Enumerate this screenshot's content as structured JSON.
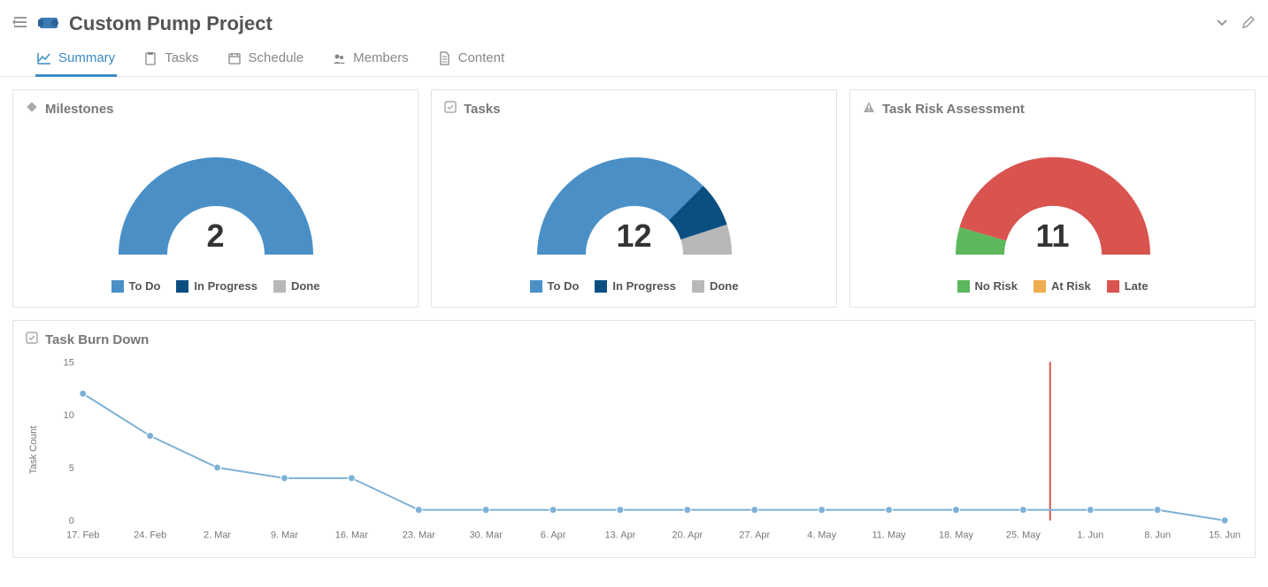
{
  "header": {
    "title": "Custom Pump Project"
  },
  "tabs": [
    {
      "label": "Summary",
      "active": true
    },
    {
      "label": "Tasks",
      "active": false
    },
    {
      "label": "Schedule",
      "active": false
    },
    {
      "label": "Members",
      "active": false
    },
    {
      "label": "Content",
      "active": false
    }
  ],
  "cards": {
    "milestones": {
      "title": "Milestones",
      "total": "2",
      "legend": [
        {
          "label": "To Do",
          "color": "#4a90c7"
        },
        {
          "label": "In Progress",
          "color": "#0b4f81"
        },
        {
          "label": "Done",
          "color": "#b8b8b8"
        }
      ]
    },
    "tasks": {
      "title": "Tasks",
      "total": "12",
      "legend": [
        {
          "label": "To Do",
          "color": "#4a90c7"
        },
        {
          "label": "In Progress",
          "color": "#0b4f81"
        },
        {
          "label": "Done",
          "color": "#b8b8b8"
        }
      ]
    },
    "risk": {
      "title": "Task Risk Assessment",
      "total": "11",
      "legend": [
        {
          "label": "No Risk",
          "color": "#5cb85c"
        },
        {
          "label": "At Risk",
          "color": "#f0ad4e"
        },
        {
          "label": "Late",
          "color": "#d9534f"
        }
      ]
    }
  },
  "burndown": {
    "title": "Task Burn Down",
    "ylabel": "Task Count",
    "yticks": [
      "0",
      "5",
      "10",
      "15"
    ]
  },
  "chart_data": [
    {
      "name": "milestones",
      "type": "pie",
      "title": "Milestones",
      "total": 2,
      "series": [
        {
          "name": "To Do",
          "value": 2
        },
        {
          "name": "In Progress",
          "value": 0
        },
        {
          "name": "Done",
          "value": 0
        }
      ]
    },
    {
      "name": "tasks",
      "type": "pie",
      "title": "Tasks",
      "total": 12,
      "series": [
        {
          "name": "To Do",
          "value": 9
        },
        {
          "name": "In Progress",
          "value": 2
        },
        {
          "name": "Done",
          "value": 1
        }
      ]
    },
    {
      "name": "risk",
      "type": "pie",
      "title": "Task Risk Assessment",
      "total": 11,
      "series": [
        {
          "name": "No Risk",
          "value": 1
        },
        {
          "name": "At Risk",
          "value": 0
        },
        {
          "name": "Late",
          "value": 10
        }
      ]
    },
    {
      "name": "burndown",
      "type": "line",
      "title": "Task Burn Down",
      "xlabel": "",
      "ylabel": "Task Count",
      "ylim": [
        0,
        15
      ],
      "today_marker": "28. May",
      "categories": [
        "17. Feb",
        "24. Feb",
        "2. Mar",
        "9. Mar",
        "16. Mar",
        "23. Mar",
        "30. Mar",
        "6. Apr",
        "13. Apr",
        "20. Apr",
        "27. Apr",
        "4. May",
        "11. May",
        "18. May",
        "25. May",
        "1. Jun",
        "8. Jun",
        "15. Jun"
      ],
      "values": [
        12,
        8,
        5,
        4,
        4,
        1,
        1,
        1,
        1,
        1,
        1,
        1,
        1,
        1,
        1,
        1,
        1,
        0
      ]
    }
  ]
}
